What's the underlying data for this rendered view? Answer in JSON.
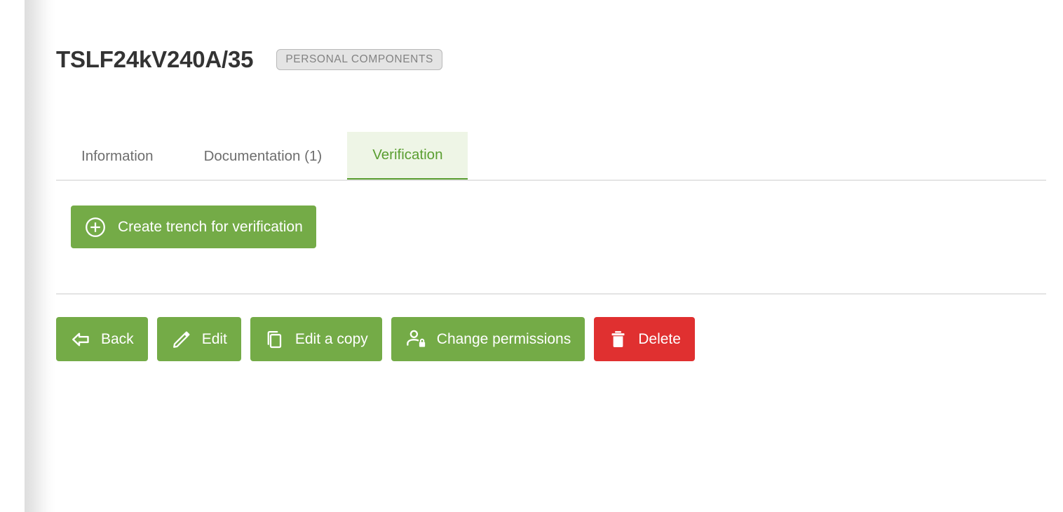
{
  "header": {
    "title": "TSLF24kV240A/35",
    "badge": "PERSONAL COMPONENTS"
  },
  "tabs": [
    {
      "label": "Information",
      "active": false
    },
    {
      "label": "Documentation (1)",
      "active": false
    },
    {
      "label": "Verification",
      "active": true
    }
  ],
  "primary_action": {
    "label": "Create trench for verification",
    "icon": "plus-circle-icon",
    "color": "#74ab47"
  },
  "footer_actions": [
    {
      "label": "Back",
      "icon": "arrow-left-icon",
      "color": "#74ab47"
    },
    {
      "label": "Edit",
      "icon": "pencil-icon",
      "color": "#74ab47"
    },
    {
      "label": "Edit a copy",
      "icon": "copy-icon",
      "color": "#74ab47"
    },
    {
      "label": "Change permissions",
      "icon": "account-lock-icon",
      "color": "#74ab47"
    },
    {
      "label": "Delete",
      "icon": "trash-icon",
      "color": "#e03030"
    }
  ],
  "colors": {
    "green": "#74ab47",
    "green_text": "#5a9e31",
    "green_tab_bg": "#eef5e6",
    "red": "#e03030",
    "title_text": "#333333",
    "tab_text": "#6e6e6e",
    "badge_bg": "#e4e4e4",
    "badge_border": "#b9b9b9",
    "badge_text": "#838383",
    "divider": "#e4e4e4"
  }
}
